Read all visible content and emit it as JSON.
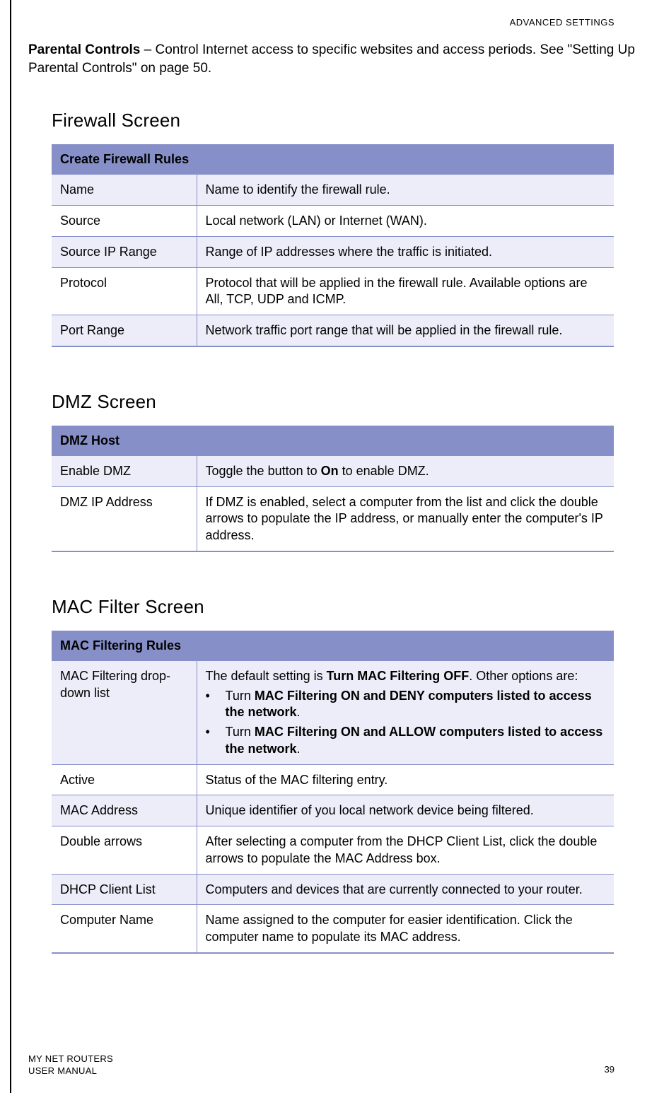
{
  "header": {
    "section_label": "ADVANCED SETTINGS"
  },
  "intro": {
    "lead_strong": "Parental Controls",
    "lead_rest": " – Control Internet access to specific websites and access periods. See \"Setting Up Parental Controls\" on page 50."
  },
  "sections": {
    "firewall": {
      "heading": "Firewall Screen",
      "table_title": "Create Firewall Rules",
      "rows": [
        {
          "k": "Name",
          "v": "Name to identify the firewall rule."
        },
        {
          "k": "Source",
          "v": "Local network (LAN) or Internet (WAN)."
        },
        {
          "k": "Source IP Range",
          "v": "Range of IP addresses where the traffic is initiated."
        },
        {
          "k": "Protocol",
          "v": "Protocol that will be applied in the firewall rule. Available options are All, TCP, UDP and ICMP."
        },
        {
          "k": "Port Range",
          "v": "Network traffic port range that will be applied in the firewall rule."
        }
      ]
    },
    "dmz": {
      "heading": "DMZ Screen",
      "table_title": "DMZ Host",
      "rows": [
        {
          "k": "Enable DMZ",
          "v_pre": "Toggle the button to ",
          "v_bold": "On",
          "v_post": " to enable DMZ."
        },
        {
          "k": "DMZ IP Address",
          "v": "If DMZ is enabled, select a computer from the list and click the double arrows to populate the IP address, or manually enter the computer's IP address."
        }
      ]
    },
    "mac": {
      "heading": "MAC Filter Screen",
      "table_title": "MAC Filtering Rules",
      "row0": {
        "k": "MAC Filtering drop-down list",
        "v_pre": "The default setting is ",
        "v_bold": "Turn MAC Filtering OFF",
        "v_post": ". Other options are:",
        "bullets": [
          {
            "pre": "Turn ",
            "bold": "MAC Filtering ON and DENY computers listed to access the network",
            "post": "."
          },
          {
            "pre": "Turn ",
            "bold": "MAC Filtering ON and ALLOW computers listed to access the network",
            "post": "."
          }
        ]
      },
      "rows": [
        {
          "k": "Active",
          "v": "Status of the MAC filtering entry."
        },
        {
          "k": "MAC Address",
          "v": "Unique identifier of you local network device being filtered."
        },
        {
          "k": "Double arrows",
          "v": "After selecting a computer from the DHCP Client List, click the double arrows to populate the MAC Address box."
        },
        {
          "k": "DHCP Client List",
          "v": "Computers and devices that are currently connected to your router."
        },
        {
          "k": "Computer Name",
          "v": "Name assigned to the computer for easier identification. Click the computer name to populate its MAC address."
        }
      ]
    }
  },
  "footer": {
    "line1": "MY NET ROUTERS",
    "line2": "USER MANUAL",
    "page_number": "39"
  }
}
